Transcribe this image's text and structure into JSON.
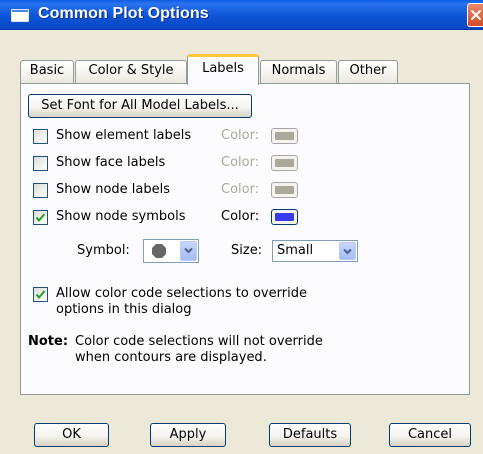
{
  "window": {
    "title": "Common Plot Options"
  },
  "tabs": [
    {
      "label": "Basic"
    },
    {
      "label": "Color & Style"
    },
    {
      "label": "Labels"
    },
    {
      "label": "Normals"
    },
    {
      "label": "Other"
    }
  ],
  "active_tab": "Labels",
  "labels_tab": {
    "set_font_button": "Set Font for All Model Labels...",
    "options": [
      {
        "label": "Show element labels",
        "checked": false,
        "color_label": "Color:",
        "color_enabled": false,
        "color": "#aca899"
      },
      {
        "label": "Show face labels",
        "checked": false,
        "color_label": "Color:",
        "color_enabled": false,
        "color": "#aca899"
      },
      {
        "label": "Show node labels",
        "checked": false,
        "color_label": "Color:",
        "color_enabled": false,
        "color": "#aca899"
      },
      {
        "label": "Show node symbols",
        "checked": true,
        "color_label": "Color:",
        "color_enabled": true,
        "color": "#3a3aef"
      }
    ],
    "symbol_label": "Symbol:",
    "symbol_value": "filled-circle-icon",
    "size_label": "Size:",
    "size_value": "Small",
    "allow_override": {
      "checked": true,
      "line1": "Allow color code selections to override",
      "line2": "options in this dialog"
    },
    "note_label": "Note:",
    "note_line1": "Color code selections will not override",
    "note_line2": "when contours are displayed."
  },
  "footer": {
    "ok": "OK",
    "apply": "Apply",
    "defaults": "Defaults",
    "cancel": "Cancel"
  },
  "colors": {
    "titlebar": "#0a5ee8",
    "active_tab_accent": "#ffc83c",
    "dialog_bg": "#ece9d8"
  }
}
